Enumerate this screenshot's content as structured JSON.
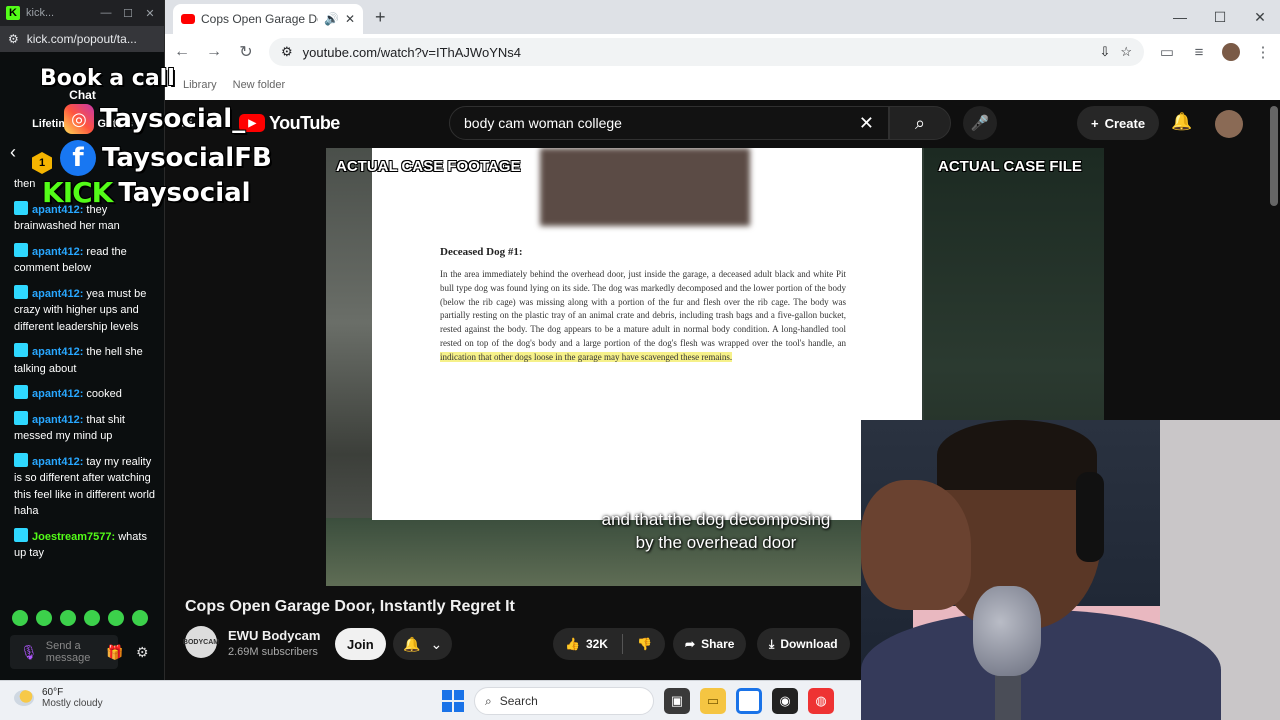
{
  "kick": {
    "window_title": "kick...",
    "url": "kick.com/popout/ta...",
    "chat_title": "Chat",
    "top_gifters": "Lifetime top Gifters",
    "gifter_rank": "1",
    "messages": [
      {
        "user": "",
        "text": "then"
      },
      {
        "user": "apant412:",
        "text": "they brainwashed her man"
      },
      {
        "user": "apant412:",
        "text": "read the comment below"
      },
      {
        "user": "apant412:",
        "text": "yea must be crazy with higher ups and different leadership levels"
      },
      {
        "user": "apant412:",
        "text": "the hell she talking about"
      },
      {
        "user": "apant412:",
        "text": "cooked"
      },
      {
        "user": "apant412:",
        "text": "that shit messed my mind up"
      },
      {
        "user": "apant412:",
        "text": "tay my reality is so different after watching this feel like in different world haha"
      },
      {
        "user": "Joestream7577:",
        "text": "whats up tay"
      }
    ],
    "input_placeholder": "Send a message"
  },
  "overlay": {
    "book": "Book a call",
    "instagram": "Taysocial_",
    "facebook": "TaysocialFB",
    "kick_logo": "KICK",
    "kick_handle": "Taysocial"
  },
  "chrome": {
    "tab_title": "Cops Open Garage Door, In",
    "url": "youtube.com/watch?v=IThAJWoYNs4",
    "bookmarks": [
      "Library",
      "New folder"
    ]
  },
  "youtube": {
    "logo": "YouTube",
    "search_query": "body cam woman college",
    "create": "Create",
    "video": {
      "tag_left": "ACTUAL CASE FOOTAGE",
      "tag_right": "ACTUAL CASE FILE",
      "doc_heading": "Deceased Dog #1:",
      "doc_body": "In the area immediately behind the overhead door, just inside the garage, a deceased adult black and white Pit bull type dog was found lying on its side. The dog was markedly decomposed and the lower portion of the body (below the rib cage) was missing along with a portion of the fur and flesh over the rib cage. The body was partially resting on the plastic tray of an animal crate and debris, including trash bags and a five-gallon bucket, rested against the body. The dog appears to be a mature adult in normal body condition. A long-handled tool rested on top of the dog's body and a large portion of the dog's flesh was wrapped over the tool's handle, an",
      "doc_highlight": "indication that other dogs loose in the garage may have scavenged these remains.",
      "caption_line1": "and that the dog decomposing",
      "caption_line2": "by the overhead door"
    },
    "title": "Cops Open Garage Door, Instantly Regret It",
    "channel": "EWU Bodycam",
    "channel_avatar_text": "BODYCAM",
    "subscribers": "2.69M subscribers",
    "join": "Join",
    "likes": "32K",
    "share": "Share",
    "download": "Download"
  },
  "taskbar": {
    "temp": "60°F",
    "condition": "Mostly cloudy",
    "search": "Search"
  }
}
